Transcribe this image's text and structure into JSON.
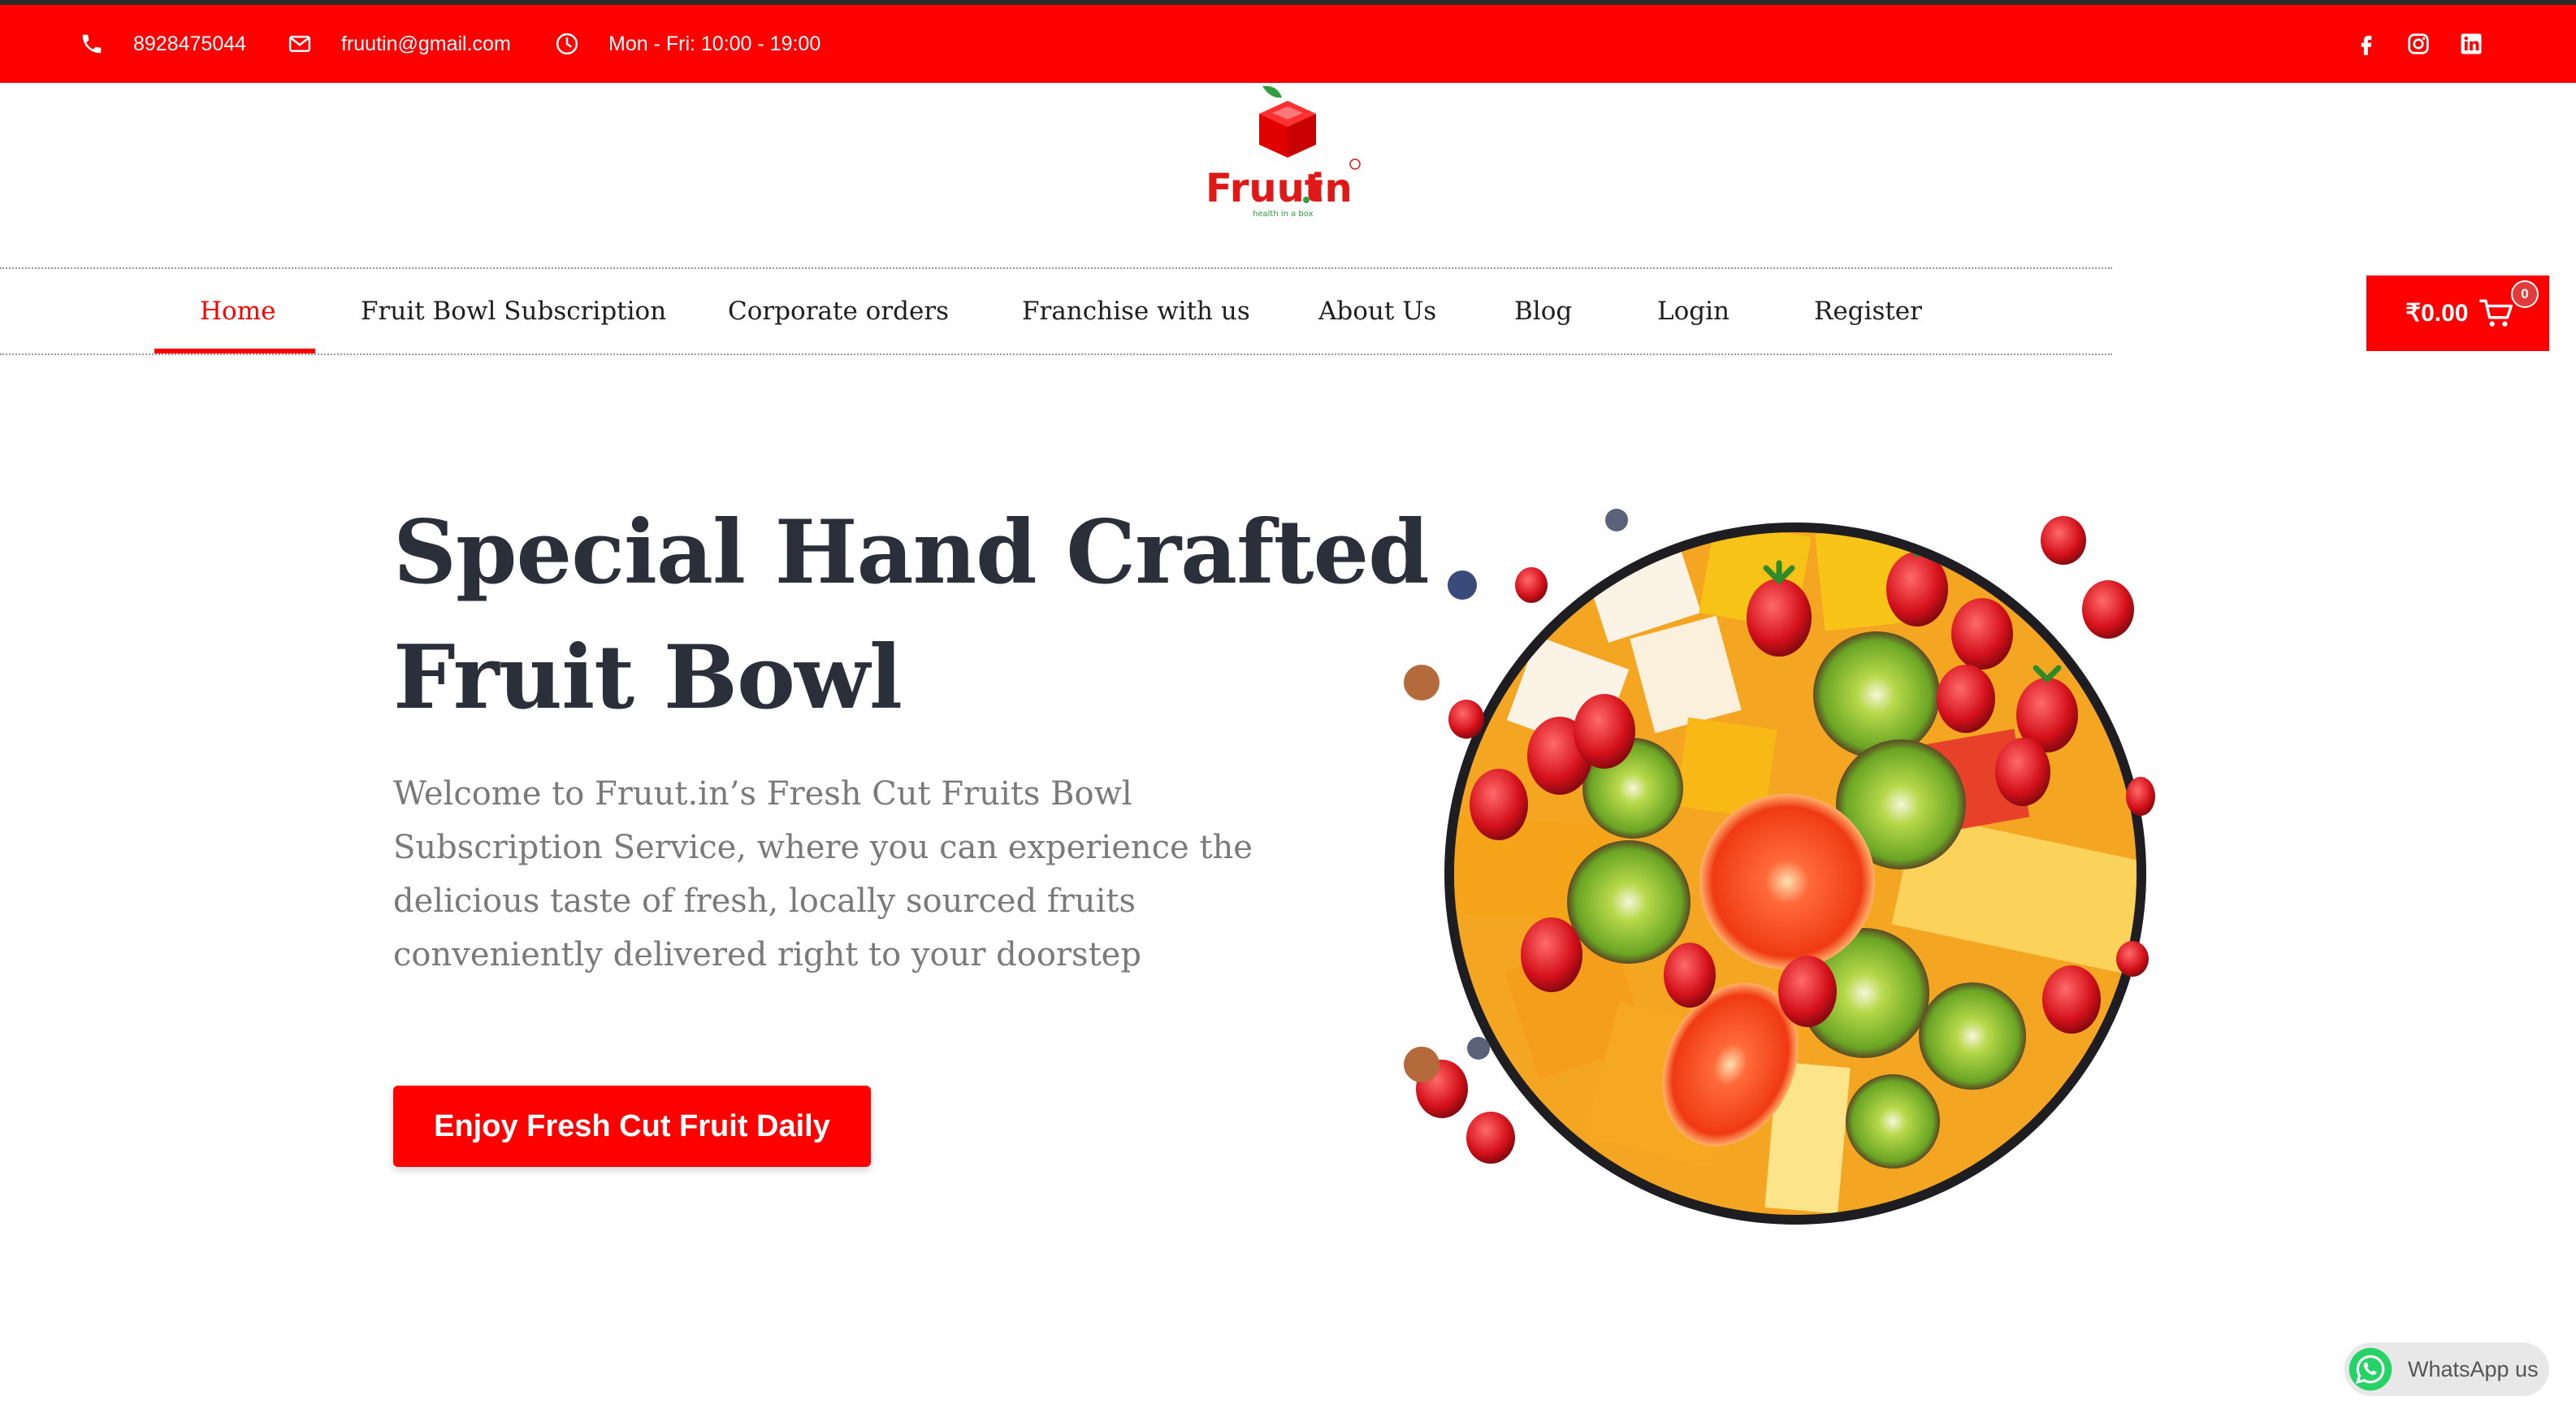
{
  "topbar": {
    "phone": "8928475044",
    "email": "fruutin@gmail.com",
    "hours": "Mon - Fri: 10:00 - 19:00",
    "social_icons": [
      "facebook-icon",
      "instagram-icon",
      "linkedin-icon"
    ],
    "background": "#ff0000"
  },
  "logo": {
    "brand": "Fruut.in",
    "tagline": "health in a box"
  },
  "nav": {
    "items": [
      {
        "label": "Home",
        "active": true
      },
      {
        "label": "Fruit Bowl Subscription"
      },
      {
        "label": "Corporate orders"
      },
      {
        "label": "Franchise with us"
      },
      {
        "label": "About Us"
      },
      {
        "label": "Blog"
      },
      {
        "label": "Login"
      },
      {
        "label": "Register"
      }
    ]
  },
  "cart": {
    "amount": "₹0.00",
    "count": "0"
  },
  "hero": {
    "title_line1": "Special Hand Crafted",
    "title_line2": "Fruit Bowl",
    "description": "Welcome to Fruut.in’s Fresh Cut Fruits Bowl Subscription Service, where you can experience the delicious taste of fresh, locally sourced fruits conveniently delivered right to your doorstep",
    "cta": "Enjoy Fresh Cut Fruit Daily"
  },
  "whatsapp": {
    "label": "WhatsApp us"
  },
  "colors": {
    "accent": "#ff0000",
    "heading": "#2a2f3a",
    "body_text": "#7a7a7a"
  }
}
